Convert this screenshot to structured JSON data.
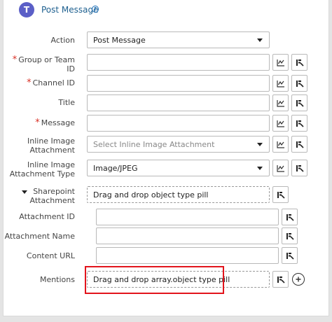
{
  "header": {
    "logo_letter": "T",
    "title": "Post Message"
  },
  "fields": {
    "action": {
      "label": "Action",
      "value": "Post Message"
    },
    "group_id": {
      "label_line1": "Group or Team",
      "label_line2": "ID",
      "value": ""
    },
    "channel_id": {
      "label": "Channel ID",
      "value": ""
    },
    "title": {
      "label": "Title",
      "value": ""
    },
    "message": {
      "label": "Message",
      "value": ""
    },
    "inline_attachment": {
      "label_line1": "Inline Image",
      "label_line2": "Attachment",
      "placeholder": "Select Inline Image Attachment"
    },
    "inline_attachment_type": {
      "label_line1": "Inline Image",
      "label_line2": "Attachment Type",
      "value": "Image/JPEG"
    },
    "sharepoint_attachment": {
      "label_line1": "Sharepoint",
      "label_line2": "Attachment",
      "placeholder": "Drag and drop object type pill"
    },
    "attachment_id": {
      "label": "Attachment ID",
      "value": ""
    },
    "attachment_name": {
      "label": "Attachment Name",
      "value": ""
    },
    "content_url": {
      "label": "Content URL",
      "value": ""
    },
    "mentions": {
      "label": "Mentions",
      "placeholder": "Drag and drop array.object type pill"
    }
  },
  "required_marker": "*",
  "colors": {
    "brand": "#5b5fc7",
    "title_link": "#1d5f8f",
    "required": "#d93025",
    "highlight": "#e2141c"
  },
  "icons": {
    "formula": "formula-icon",
    "pill_picker": "pill-picker-icon",
    "add": "add-circle-icon",
    "help": "help-icon"
  }
}
